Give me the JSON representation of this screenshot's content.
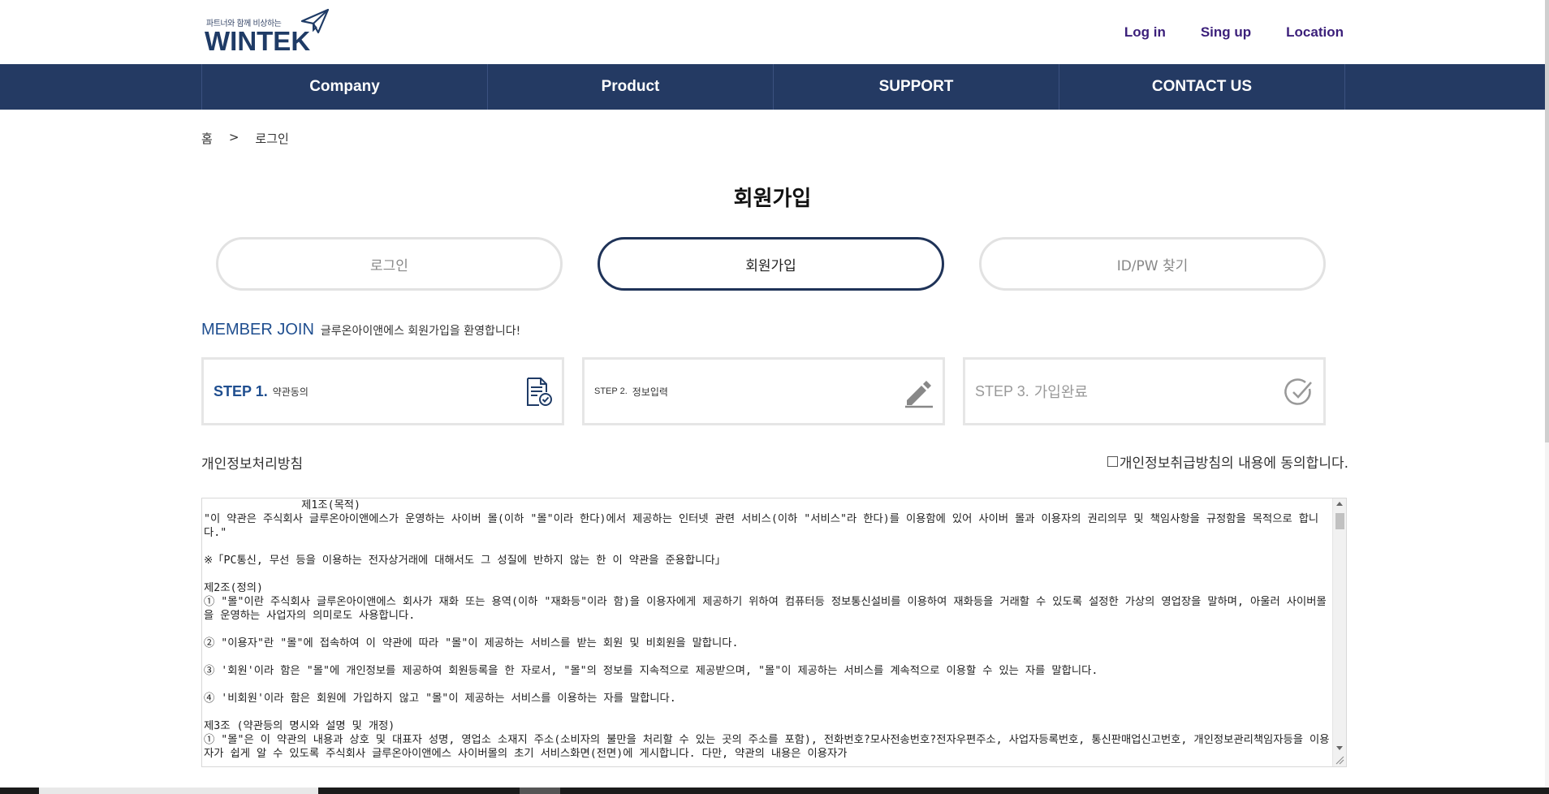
{
  "header": {
    "logo_tagline": "파트너와 함께 비상하는",
    "logo_text": "WINTEK",
    "links": [
      "Log in",
      "Sing up",
      "Location"
    ]
  },
  "nav": [
    "Company",
    "Product",
    "SUPPORT",
    "CONTACT US"
  ],
  "breadcrumb": {
    "home": "홈",
    "sep": ">",
    "current": "로그인"
  },
  "title": "회원가입",
  "tabs": [
    "로그인",
    "회원가입",
    "ID/PW 찾기"
  ],
  "member_join": {
    "title": "MEMBER JOIN",
    "subtitle": "글루온아이앤에스 회원가입을 환영합니다!"
  },
  "steps": [
    {
      "num": "STEP 1.",
      "name": "약관동의",
      "icon": "document-check-icon"
    },
    {
      "num": "STEP 2.",
      "name": "정보입력",
      "icon": "pencil-icon"
    },
    {
      "num": "STEP 3.",
      "name": "가입완료",
      "icon": "check-circle-icon"
    }
  ],
  "privacy": {
    "title": "개인정보처리방침",
    "agree_label": "개인정보취급방침의 내용에 동의합니다."
  },
  "terms_text": "               제1조(목적)\n\"이 약관은 주식회사 글루온아이앤에스가 운영하는 사이버 몰(이하 \"몰\"이라 한다)에서 제공하는 인터넷 관련 서비스(이하 \"서비스\"라 한다)를 이용함에 있어 사이버 몰과 이용자의 권리의무 및 책임사항을 규정함을 목적으로 합니다.\"\n\n※「PC통신, 무선 등을 이용하는 전자상거래에 대해서도 그 성질에 반하지 않는 한 이 약관을 준용합니다」\n\n제2조(정의)\n① \"몰\"이란 주식회사 글루온아이앤에스 회사가 재화 또는 용역(이하 \"재화등\"이라 함)을 이용자에게 제공하기 위하여 컴퓨터등 정보통신설비를 이용하여 재화등을 거래할 수 있도록 설정한 가상의 영업장을 말하며, 아울러 사이버몰을 운영하는 사업자의 의미로도 사용합니다.\n\n② \"이용자\"란 \"몰\"에 접속하여 이 약관에 따라 \"몰\"이 제공하는 서비스를 받는 회원 및 비회원을 말합니다.\n\n③ '회원'이라 함은 \"몰\"에 개인정보를 제공하여 회원등록을 한 자로서, \"몰\"의 정보를 지속적으로 제공받으며, \"몰\"이 제공하는 서비스를 계속적으로 이용할 수 있는 자를 말합니다.\n\n④ '비회원'이라 함은 회원에 가입하지 않고 \"몰\"이 제공하는 서비스를 이용하는 자를 말합니다.\n\n제3조 (약관등의 명시와 설명 및 개정)\n① \"몰\"은 이 약관의 내용과 상호 및 대표자 성명, 영업소 소재지 주소(소비자의 불만을 처리할 수 있는 곳의 주소를 포함), 전화번호?모사전송번호?전자우편주소, 사업자등록번호, 통신판매업신고번호, 개인정보관리책임자등을 이용자가 쉽게 알 수 있도록 주식회사 글루온아이앤에스 사이버몰의 초기 서비스화면(전면)에 게시합니다. 다만, 약관의 내용은 이용자가"
}
